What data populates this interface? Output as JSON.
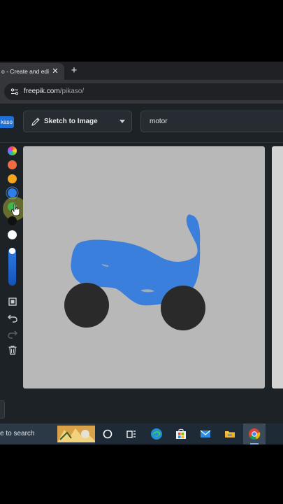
{
  "browser": {
    "tab_title": "o - Create and edi",
    "close_symbol": "✕",
    "new_tab_symbol": "+",
    "url_host": "freepik.com",
    "url_path": "/pikaso/"
  },
  "app": {
    "brand_pill": "kaso",
    "mode_label": "Sketch to Image",
    "prompt_value": "motor"
  },
  "tools": {
    "swatches": [
      "rainbow",
      "#f26b43",
      "#f7a51c",
      "#2f7de6",
      "#3fb64a",
      "#111111",
      "#ffffff"
    ],
    "selected_swatch": "#3fb64a",
    "icons": [
      "square-tool-icon",
      "undo-icon",
      "redo-icon",
      "trash-icon"
    ]
  },
  "sketch": {
    "stroke_color": "#3b7fdc",
    "wheel_color": "#2a2a2a",
    "canvas_color": "#b8b8b8"
  },
  "taskbar": {
    "search_text": "e to search",
    "icons": [
      "task-view-icon",
      "widgets-icon",
      "edge-icon",
      "store-icon",
      "mail-icon",
      "file-explorer-icon",
      "chrome-icon"
    ]
  }
}
